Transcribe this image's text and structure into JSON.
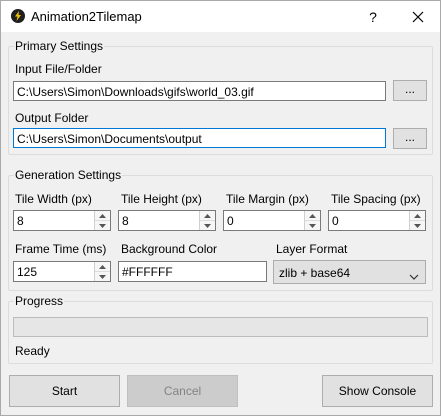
{
  "window": {
    "title": "Animation2Tilemap"
  },
  "primary": {
    "title": "Primary Settings",
    "input_label": "Input File/Folder",
    "input_value": "C:\\Users\\Simon\\Downloads\\gifs\\world_03.gif",
    "output_label": "Output Folder",
    "output_value": "C:\\Users\\Simon\\Documents\\output",
    "browse_label": "..."
  },
  "generation": {
    "title": "Generation Settings",
    "tile_width_label": "Tile Width (px)",
    "tile_width": "8",
    "tile_height_label": "Tile Height (px)",
    "tile_height": "8",
    "tile_margin_label": "Tile Margin (px)",
    "tile_margin": "0",
    "tile_spacing_label": "Tile Spacing (px)",
    "tile_spacing": "0",
    "frame_time_label": "Frame Time (ms)",
    "frame_time": "125",
    "bg_color_label": "Background Color",
    "bg_color": "#FFFFFF",
    "layer_format_label": "Layer Format",
    "layer_format": "zlib + base64"
  },
  "progress": {
    "title": "Progress",
    "value": 0,
    "status": "Ready"
  },
  "buttons": {
    "start": "Start",
    "cancel": "Cancel",
    "console": "Show Console"
  },
  "colors": {
    "focus": "#0078d7",
    "window_bg": "#f0f0f0"
  }
}
